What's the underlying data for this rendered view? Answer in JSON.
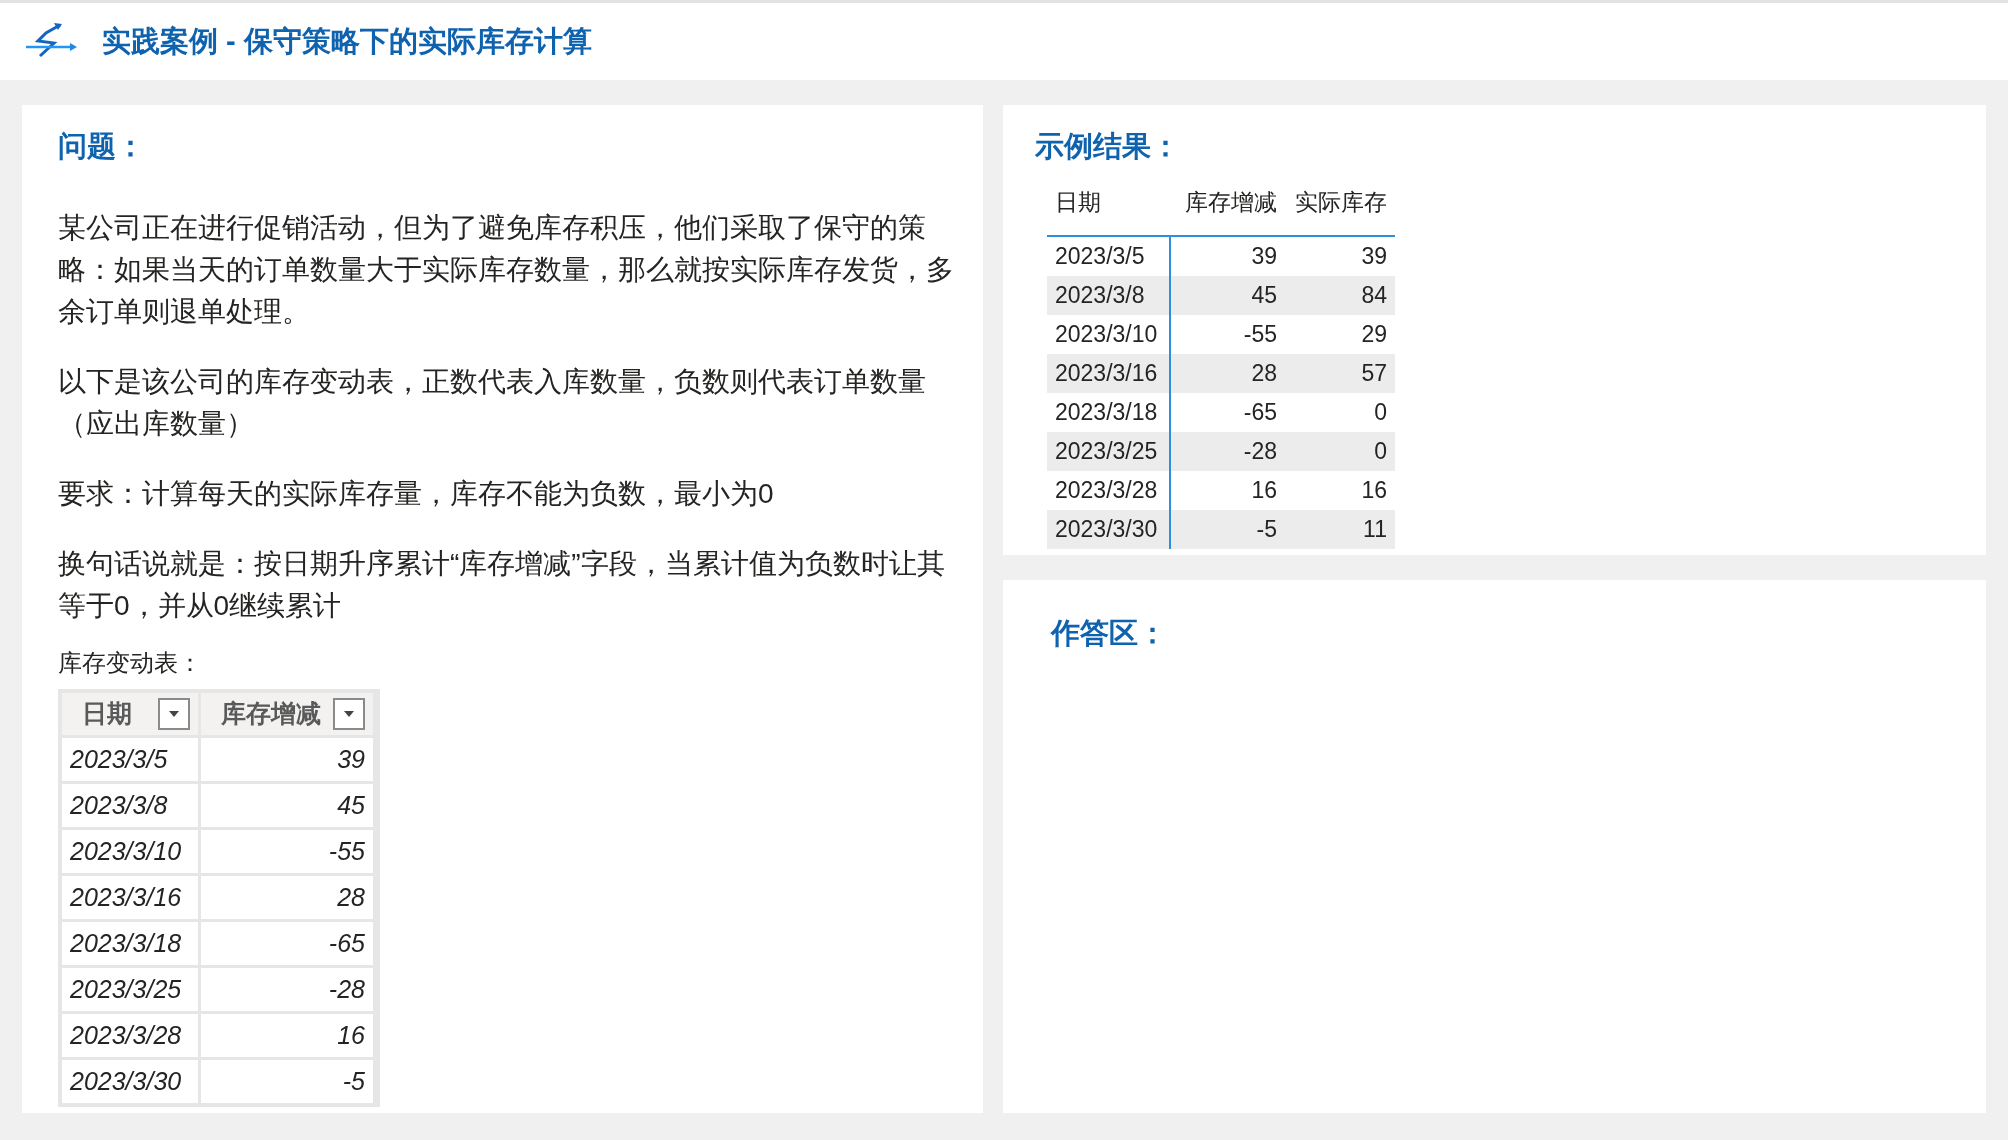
{
  "header": {
    "title": "实践案例 - 保守策略下的实际库存计算"
  },
  "problem": {
    "heading": "问题：",
    "paragraphs": [
      "某公司正在进行促销活动，但为了避免库存积压，他们采取了保守的策略：如果当天的订单数量大于实际库存数量，那么就按实际库存发货，多余订单则退单处理。",
      "以下是该公司的库存变动表，正数代表入库数量，负数则代表订单数量（应出库数量）",
      "要求：计算每天的实际库存量，库存不能为负数，最小为0",
      "换句话说就是：按日期升序累计“库存增减”字段，当累计值为负数时让其等于0，并从0继续累计"
    ],
    "table_caption": "库存变动表：",
    "table": {
      "columns": [
        "日期",
        "库存增减"
      ],
      "rows": [
        [
          "2023/3/5",
          "39"
        ],
        [
          "2023/3/8",
          "45"
        ],
        [
          "2023/3/10",
          "-55"
        ],
        [
          "2023/3/16",
          "28"
        ],
        [
          "2023/3/18",
          "-65"
        ],
        [
          "2023/3/25",
          "-28"
        ],
        [
          "2023/3/28",
          "16"
        ],
        [
          "2023/3/30",
          "-5"
        ]
      ]
    }
  },
  "result": {
    "heading": "示例结果：",
    "columns": [
      "日期",
      "库存增减",
      "实际库存"
    ],
    "rows": [
      [
        "2023/3/5",
        "39",
        "39"
      ],
      [
        "2023/3/8",
        "45",
        "84"
      ],
      [
        "2023/3/10",
        "-55",
        "29"
      ],
      [
        "2023/3/16",
        "28",
        "57"
      ],
      [
        "2023/3/18",
        "-65",
        "0"
      ],
      [
        "2023/3/25",
        "-28",
        "0"
      ],
      [
        "2023/3/28",
        "16",
        "16"
      ],
      [
        "2023/3/30",
        "-5",
        "11"
      ]
    ]
  },
  "answer": {
    "heading": "作答区："
  }
}
